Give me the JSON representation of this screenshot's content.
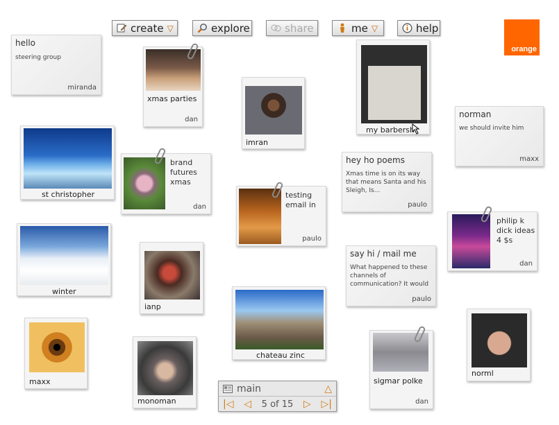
{
  "toolbar": {
    "create": "create",
    "explore": "explore",
    "share": "share",
    "me": "me",
    "help": "help"
  },
  "logo": "orange",
  "colors": {
    "accent": "#ff6600",
    "arrow": "#d07a10"
  },
  "cards": {
    "hello": {
      "title": "hello",
      "body": "steering group",
      "author": "miranda"
    },
    "xmas_parties": {
      "caption": "xmas parties",
      "author": "dan"
    },
    "imran": {
      "caption": "imran"
    },
    "barbershop": {
      "caption": "my barbersh"
    },
    "norman": {
      "title": "norman",
      "body": "we should invite him",
      "author": "maxx"
    },
    "st_christopher": {
      "caption": "st christopher"
    },
    "brand": {
      "line1": "brand",
      "line2": "futures",
      "line3": "xmas",
      "author": "dan"
    },
    "testing": {
      "line1": "testing",
      "line2": "email in",
      "author": "paulo"
    },
    "poems": {
      "title": "hey ho poems",
      "body": "Xmas time is on its way that means Santa and his Sleigh, Is...",
      "author": "paulo"
    },
    "philip": {
      "line1": "philip k",
      "line2": "dick ideas",
      "line3": "4 $s",
      "author": "dan"
    },
    "winter": {
      "caption": "winter"
    },
    "ianp": {
      "caption": "ianp"
    },
    "sayhi": {
      "title": "say hi / mail me",
      "body": "What happened to these channels of communication? It would",
      "author": "paulo"
    },
    "chateau": {
      "caption": "chateau zinc"
    },
    "maxx": {
      "caption": "maxx"
    },
    "monoman": {
      "caption": "monoman"
    },
    "sigmar": {
      "caption": "sigmar polke",
      "author": "dan"
    },
    "norml": {
      "caption": "norml"
    }
  },
  "nav": {
    "channel": "main",
    "page": "5 of 15"
  }
}
